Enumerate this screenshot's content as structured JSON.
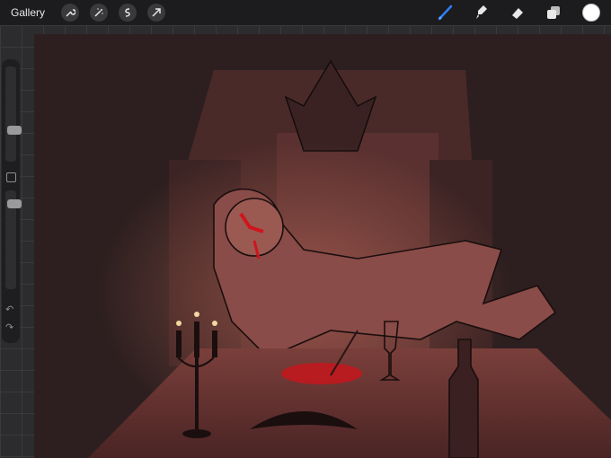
{
  "topbar": {
    "gallery_label": "Gallery",
    "left_icons": [
      "wrench-icon",
      "magic-wand-icon",
      "selection-icon",
      "transform-arrow-icon"
    ],
    "right_icons": [
      "brush-icon",
      "smudge-icon",
      "eraser-icon",
      "layers-icon"
    ],
    "active_tool": "brush",
    "active_color": "#ffffff",
    "accent_color": "#2d7ff9"
  },
  "sidebar": {
    "brush_size_level": 0.22,
    "opacity_level": 0.45
  },
  "canvas": {
    "background_color": "#2a1c1c",
    "highlight_color": "#c85a4a",
    "blood_color": "#d0141c"
  }
}
